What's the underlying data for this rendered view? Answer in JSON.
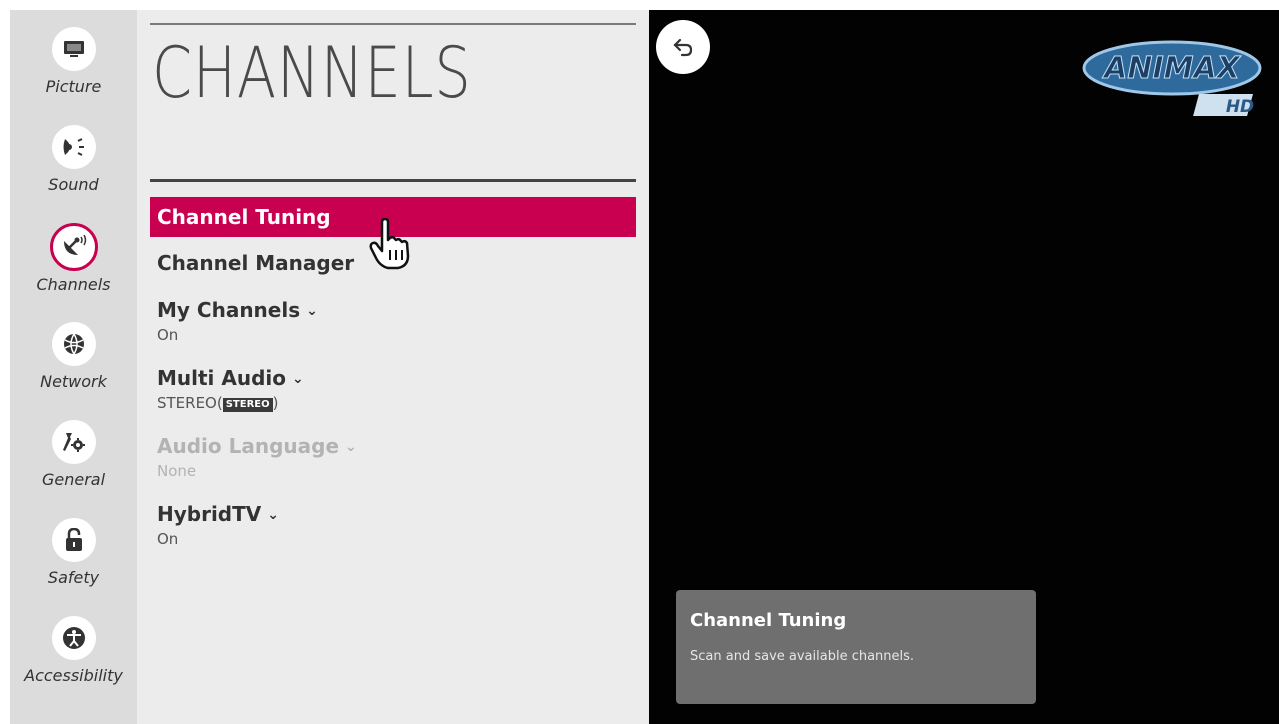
{
  "sidebar": {
    "items": [
      {
        "label": "Picture",
        "icon": "picture-icon"
      },
      {
        "label": "Sound",
        "icon": "sound-icon"
      },
      {
        "label": "Channels",
        "icon": "channels-icon",
        "active": true
      },
      {
        "label": "Network",
        "icon": "network-icon"
      },
      {
        "label": "General",
        "icon": "general-icon"
      },
      {
        "label": "Safety",
        "icon": "safety-icon"
      },
      {
        "label": "Accessibility",
        "icon": "accessibility-icon"
      }
    ]
  },
  "panel": {
    "title": "CHANNELS",
    "items": [
      {
        "label": "Channel Tuning",
        "selected": true
      },
      {
        "label": "Channel Manager"
      },
      {
        "label": "My Channels",
        "value": "On",
        "dropdown": true
      },
      {
        "label": "Multi Audio",
        "value": "STEREO(",
        "badge": "STEREO",
        "value_suffix": ")",
        "dropdown": true
      },
      {
        "label": "Audio Language",
        "value": "None",
        "dropdown": true,
        "disabled": true
      },
      {
        "label": "HybridTV",
        "value": "On",
        "dropdown": true
      }
    ]
  },
  "video": {
    "logo_text": "ANIMAX",
    "logo_sub": "HD"
  },
  "info": {
    "title": "Channel Tuning",
    "description": "Scan and save available channels."
  },
  "colors": {
    "accent": "#c8004f",
    "panel_bg": "#ececec",
    "rail_bg": "#dcdcdc",
    "info_bg": "#6f6f6f"
  }
}
